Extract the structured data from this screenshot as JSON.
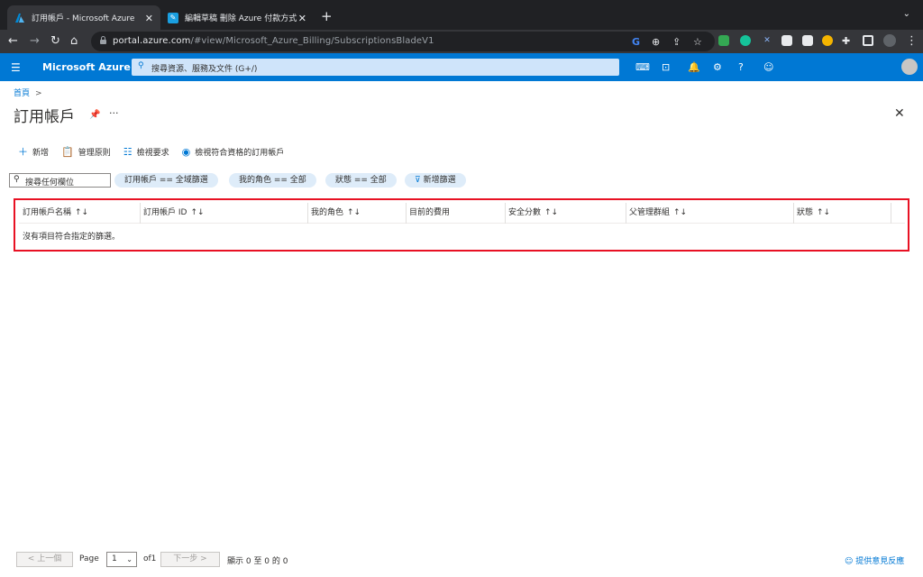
{
  "browser": {
    "tabs": [
      {
        "title": "訂用帳戶 - Microsoft Azure",
        "active": true
      },
      {
        "title": "編輯草稿 刪除 Azure 付款方式",
        "active": false
      }
    ],
    "url_host": "portal.azure.com",
    "url_path": "/#view/Microsoft_Azure_Billing/SubscriptionsBladeV1"
  },
  "azure": {
    "brand": "Microsoft Azure",
    "search_placeholder": "搜尋資源、服務及文件 (G+/)"
  },
  "breadcrumb": {
    "home": "首頁",
    "sep": ">"
  },
  "page": {
    "title": "訂用帳戶"
  },
  "commands": [
    {
      "label": "新增",
      "icon": "plus-icon"
    },
    {
      "label": "管理原則",
      "icon": "clipboard-icon"
    },
    {
      "label": "檢視要求",
      "icon": "list-icon"
    },
    {
      "label": "檢視符合資格的訂用帳戶",
      "icon": "eye-icon"
    }
  ],
  "filters": {
    "search_placeholder": "搜尋任何欄位",
    "pills": [
      "訂用帳戶 == 全域篩選",
      "我的角色 == 全部",
      "狀態 == 全部"
    ],
    "add_filter": "新增篩選"
  },
  "table": {
    "columns": [
      "訂用帳戶名稱",
      "訂用帳戶 ID",
      "我的角色",
      "目前的費用",
      "安全分數",
      "父管理群組",
      "狀態"
    ],
    "sortable": [
      true,
      true,
      true,
      false,
      true,
      true,
      true
    ],
    "empty_message": "沒有項目符合指定的篩選。"
  },
  "pager": {
    "prev": "< 上一個",
    "page_label": "Page",
    "page_value": "1",
    "of_label": "of1",
    "next": "下一步 >",
    "summary": "顯示 0 至 0 的 0"
  },
  "feedback": "提供意見反應",
  "colors": {
    "azure_blue": "#0078d4",
    "highlight_border": "#e81123"
  }
}
